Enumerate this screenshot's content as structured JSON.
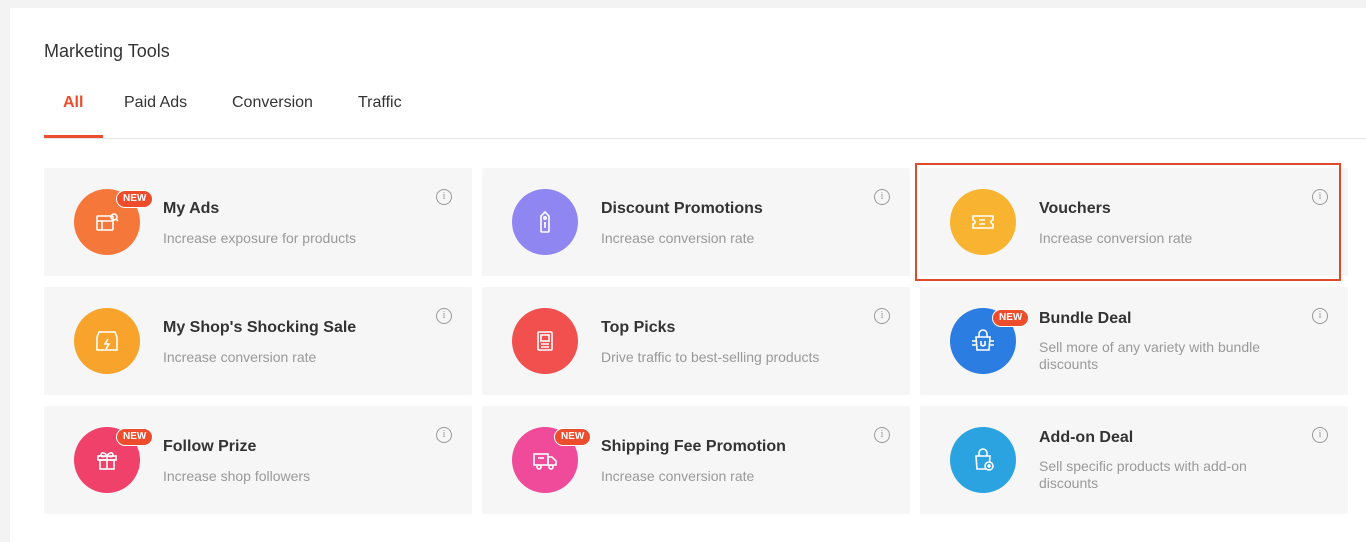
{
  "header": {
    "title": "Marketing Tools"
  },
  "tabs": [
    {
      "label": "All"
    },
    {
      "label": "Paid Ads"
    },
    {
      "label": "Conversion"
    },
    {
      "label": "Traffic"
    }
  ],
  "tools": [
    {
      "name": "My Ads",
      "desc": "Increase exposure for products",
      "badge": "NEW",
      "icon": "ads-shop-icon",
      "color": "#f5783a"
    },
    {
      "name": "Discount Promotions",
      "desc": "Increase conversion rate",
      "badge": "",
      "icon": "price-tag-icon",
      "color": "#8f86f2"
    },
    {
      "name": "Vouchers",
      "desc": "Increase conversion rate",
      "badge": "",
      "icon": "voucher-ticket-icon",
      "color": "#f8b431"
    },
    {
      "name": "My Shop's Shocking Sale",
      "desc": "Increase conversion rate",
      "badge": "",
      "icon": "flash-sale-store-icon",
      "color": "#f8a42c"
    },
    {
      "name": "Top Picks",
      "desc": "Drive traffic to best-selling products",
      "badge": "",
      "icon": "top-picks-board-icon",
      "color": "#f24f4f"
    },
    {
      "name": "Bundle Deal",
      "desc": "Sell more of any variety with bundle discounts",
      "badge": "NEW",
      "icon": "bundle-bag-icon",
      "color": "#2b7de1"
    },
    {
      "name": "Follow Prize",
      "desc": "Increase shop followers",
      "badge": "NEW",
      "icon": "gift-icon",
      "color": "#f0416a"
    },
    {
      "name": "Shipping Fee Promotion",
      "desc": "Increase conversion rate",
      "badge": "NEW",
      "icon": "delivery-truck-icon",
      "color": "#f04b9a"
    },
    {
      "name": "Add-on Deal",
      "desc": "Sell specific products with add-on discounts",
      "badge": "",
      "icon": "add-on-bag-icon",
      "color": "#2ba3e0"
    }
  ],
  "info_glyph": "i"
}
